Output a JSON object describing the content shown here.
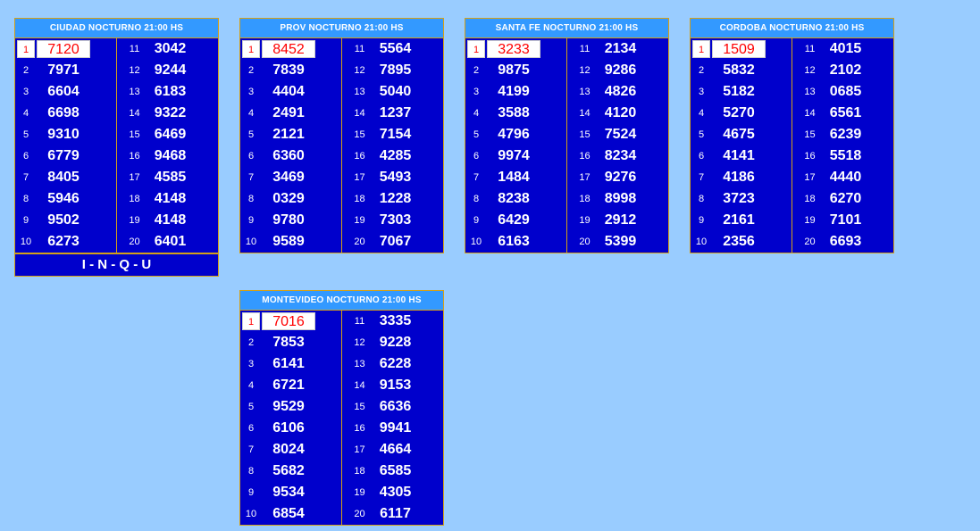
{
  "boards": [
    {
      "title": "CIUDAD NOCTURNO 21:00 HS",
      "left": [
        "7120",
        "7971",
        "6604",
        "6698",
        "9310",
        "6779",
        "8405",
        "5946",
        "9502",
        "6273"
      ],
      "right": [
        "3042",
        "9244",
        "6183",
        "9322",
        "6469",
        "9468",
        "4585",
        "4148",
        "4148",
        "6401"
      ]
    },
    {
      "title": "PROV NOCTURNO 21:00 HS",
      "left": [
        "8452",
        "7839",
        "4404",
        "2491",
        "2121",
        "6360",
        "3469",
        "0329",
        "9780",
        "9589"
      ],
      "right": [
        "5564",
        "7895",
        "5040",
        "1237",
        "7154",
        "4285",
        "5493",
        "1228",
        "7303",
        "7067"
      ]
    },
    {
      "title": "SANTA FE NOCTURNO 21:00 HS",
      "left": [
        "3233",
        "9875",
        "4199",
        "3588",
        "4796",
        "9974",
        "1484",
        "8238",
        "6429",
        "6163"
      ],
      "right": [
        "2134",
        "9286",
        "4826",
        "4120",
        "7524",
        "8234",
        "9276",
        "8998",
        "2912",
        "5399"
      ]
    },
    {
      "title": "CORDOBA NOCTURNO 21:00 HS",
      "left": [
        "1509",
        "5832",
        "5182",
        "5270",
        "4675",
        "4141",
        "4186",
        "3723",
        "2161",
        "2356"
      ],
      "right": [
        "4015",
        "2102",
        "0685",
        "6561",
        "6239",
        "5518",
        "4440",
        "6270",
        "7101",
        "6693"
      ]
    },
    {
      "title": "MONTEVIDEO NOCTURNO 21:00 HS",
      "left": [
        "7016",
        "7853",
        "6141",
        "6721",
        "9529",
        "6106",
        "8024",
        "5682",
        "9534",
        "6854"
      ],
      "right": [
        "3335",
        "9228",
        "6228",
        "9153",
        "6636",
        "9941",
        "4664",
        "6585",
        "4305",
        "6117"
      ]
    }
  ],
  "positions_left": [
    "1",
    "2",
    "3",
    "4",
    "5",
    "6",
    "7",
    "8",
    "9",
    "10"
  ],
  "positions_right": [
    "11",
    "12",
    "13",
    "14",
    "15",
    "16",
    "17",
    "18",
    "19",
    "20"
  ],
  "footer_label": "I - N - Q - U",
  "colors": {
    "background": "#99ccff",
    "board": "#0000cc",
    "header": "#3399ff",
    "border": "#d4a017",
    "first_prize": "#ff0000"
  }
}
